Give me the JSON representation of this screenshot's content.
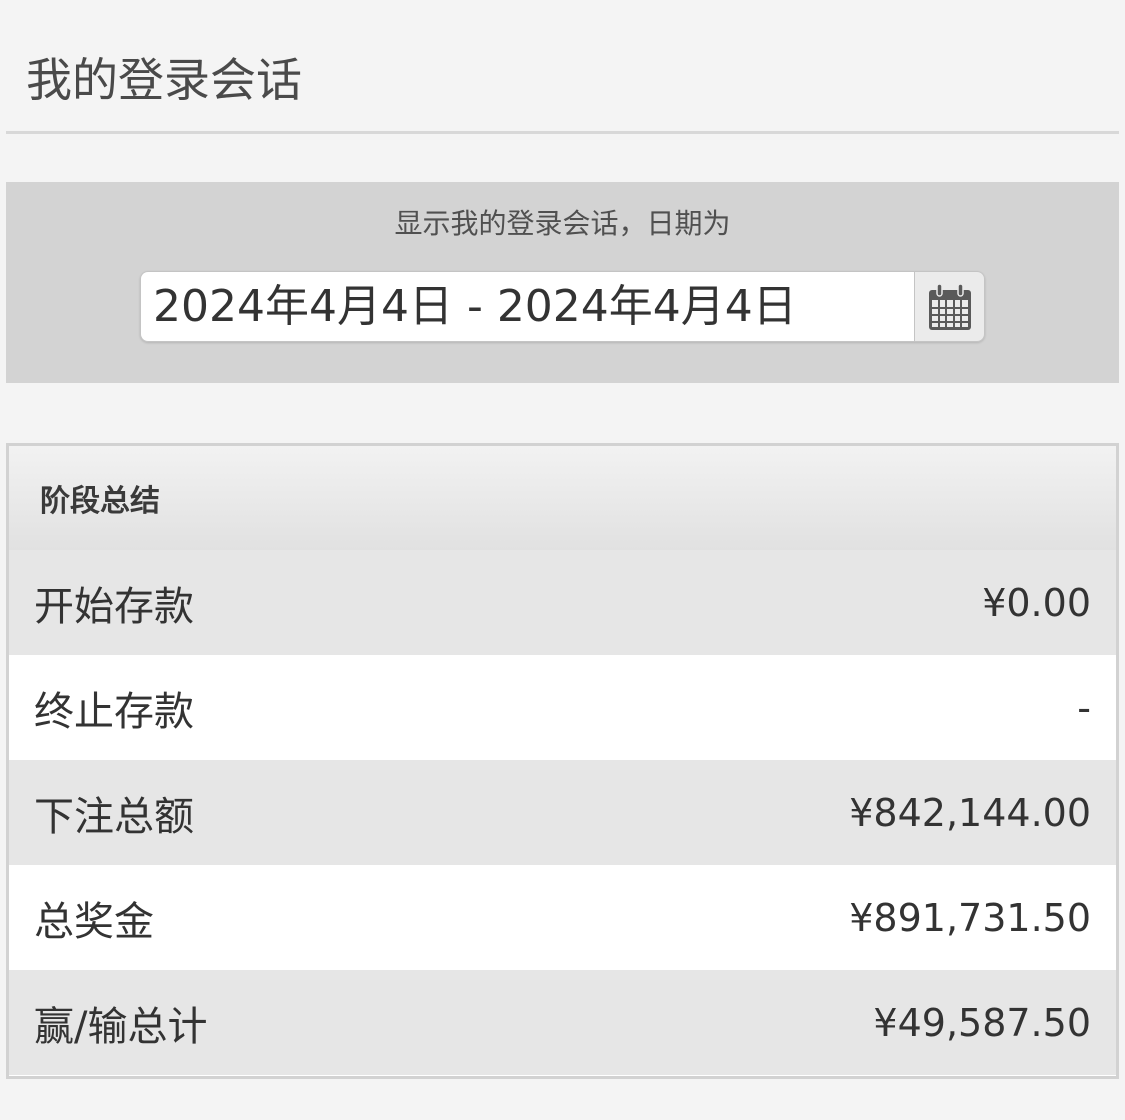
{
  "header": {
    "title": "我的登录会话"
  },
  "filter": {
    "label": "显示我的登录会话，日期为",
    "date_range": "2024年4月4日 - 2024年4月4日",
    "calendar_icon": "calendar-icon"
  },
  "summary": {
    "title": "阶段总结",
    "rows": [
      {
        "label": "开始存款",
        "value": "¥0.00"
      },
      {
        "label": "终止存款",
        "value": "-"
      },
      {
        "label": "下注总额",
        "value": "¥842,144.00"
      },
      {
        "label": "总奖金",
        "value": "¥891,731.50"
      },
      {
        "label": "赢/输总计",
        "value": "¥49,587.50"
      }
    ]
  },
  "colors": {
    "background": "#f4f4f4",
    "panel": "#d3d3d3",
    "row_shaded": "#e6e6e6",
    "row_plain": "#ffffff",
    "text": "#333333"
  }
}
